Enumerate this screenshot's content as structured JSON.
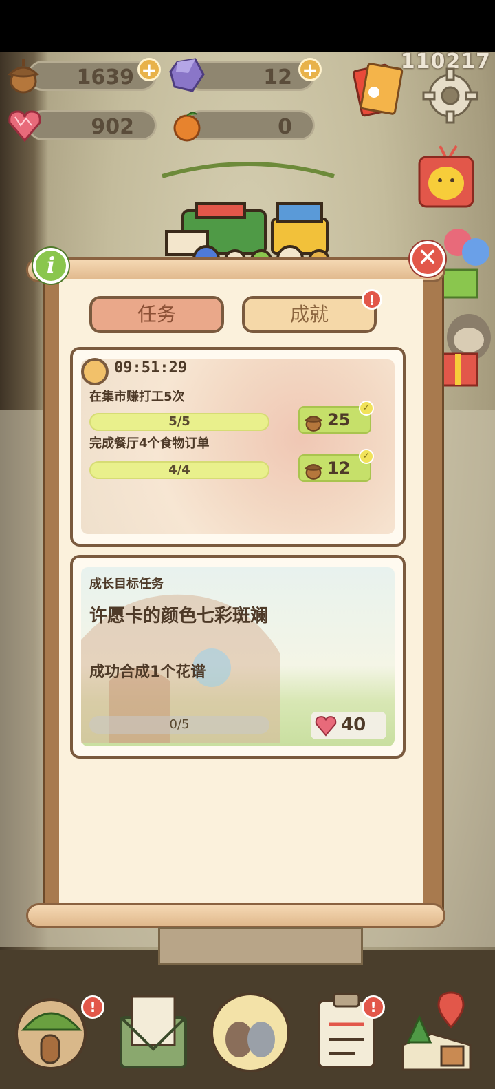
{
  "counter": "110217",
  "resources": {
    "acorn": "1639",
    "gem": "12",
    "heart": "902",
    "orange": "0"
  },
  "tabs": {
    "tasks": "任务",
    "achievements": "成就"
  },
  "badge_text": "!",
  "daily": {
    "timer": "09:51:29",
    "tasks": [
      {
        "title": "在集市赚打工5次",
        "progress": "5/5",
        "reward": "25"
      },
      {
        "title": "完成餐厅4个食物订单",
        "progress": "4/4",
        "reward": "12"
      }
    ]
  },
  "growth": {
    "label": "成长目标任务",
    "title": "许愿卡的颜色七彩斑斓",
    "task": "成功合成1个花谱",
    "progress": "0/5",
    "reward": "40"
  },
  "buttons": {
    "close": "✕",
    "info": "i",
    "plus": "+"
  },
  "colors": {
    "tab_active": "#eaa88a",
    "tab_inactive": "#f5d8a8",
    "progress_bar": "#e9f08c",
    "reward_bg": "#c6e06a",
    "badge": "#e2574a"
  }
}
